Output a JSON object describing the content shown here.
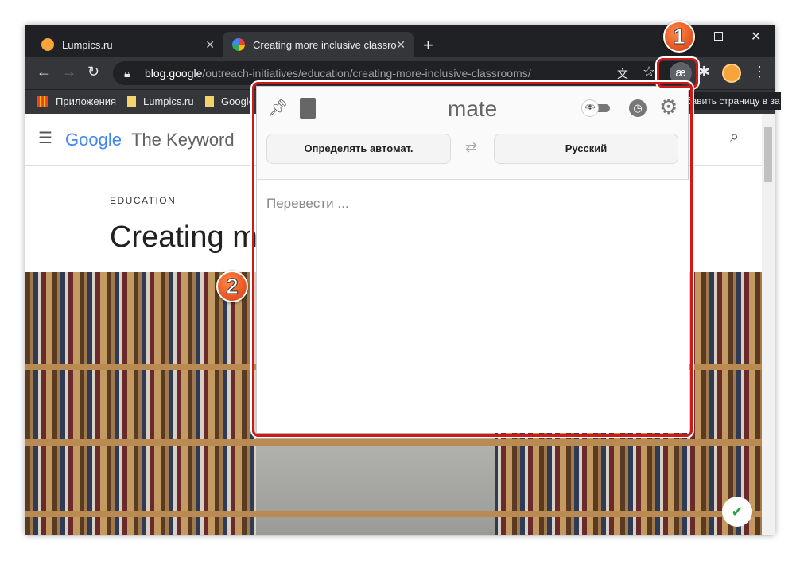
{
  "tabs": [
    {
      "label": "Lumpics.ru",
      "active": false
    },
    {
      "label": "Creating more inclusive classroor",
      "active": true
    }
  ],
  "new_tab": "+",
  "url": {
    "host": "blog.google",
    "path": "/outreach-initiatives/education/creating-more-inclusive-classrooms/"
  },
  "bookmarks": [
    "Приложения",
    "Lumpics.ru",
    "Google"
  ],
  "tooltip": "Добавить страницу в за",
  "page": {
    "brand": "Google",
    "site": "The Keyword",
    "category": "EDUCATION",
    "title": "Creating m"
  },
  "mate": {
    "logo": "mate",
    "source_lang": "Определять автомат.",
    "target_lang": "Русский",
    "input_placeholder": "Перевести ..."
  },
  "badges": [
    "1",
    "2"
  ],
  "colors": {
    "highlight": "#d01a1a",
    "tabbar": "#202124",
    "toolbar": "#35363a"
  }
}
